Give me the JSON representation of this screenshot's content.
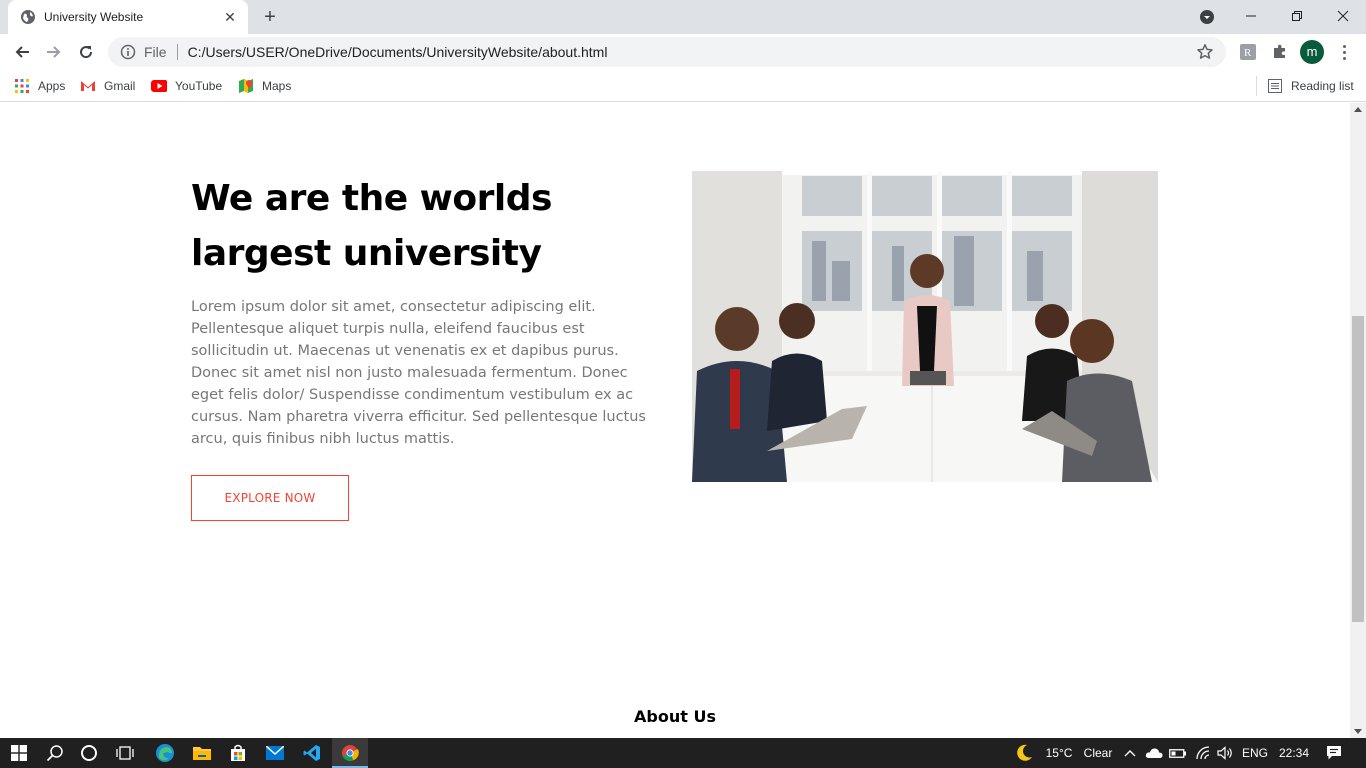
{
  "browser": {
    "tab_title": "University Website",
    "url_scheme": "File",
    "url": "C:/Users/USER/OneDrive/Documents/UniversityWebsite/about.html",
    "profile_initial": "m",
    "bookmarks": [
      {
        "label": "Apps",
        "icon": "apps-grid-icon"
      },
      {
        "label": "Gmail",
        "icon": "gmail-icon"
      },
      {
        "label": "YouTube",
        "icon": "youtube-icon"
      },
      {
        "label": "Maps",
        "icon": "maps-icon"
      }
    ],
    "reading_list": "Reading list"
  },
  "page": {
    "hero_title": "We are the worlds largest university",
    "hero_text": "Lorem ipsum dolor sit amet, consectetur adipiscing elit. Pellentesque aliquet turpis nulla, eleifend faucibus est sollicitudin ut. Maecenas ut venenatis ex et dapibus purus. Donec sit amet nisl non justo malesuada fermentum. Donec eget felis dolor/ Suspendisse condimentum vestibulum ex ac cursus. Nam pharetra viverra efficitur. Sed pellentesque luctus arcu, quis finibus nibh luctus mattis.",
    "explore_button": "EXPLORE NOW",
    "about_heading": "About Us",
    "accent_color": "#f44336"
  },
  "taskbar": {
    "weather_temp": "15°C",
    "weather_desc": "Clear",
    "language": "ENG",
    "time": "22:34"
  }
}
